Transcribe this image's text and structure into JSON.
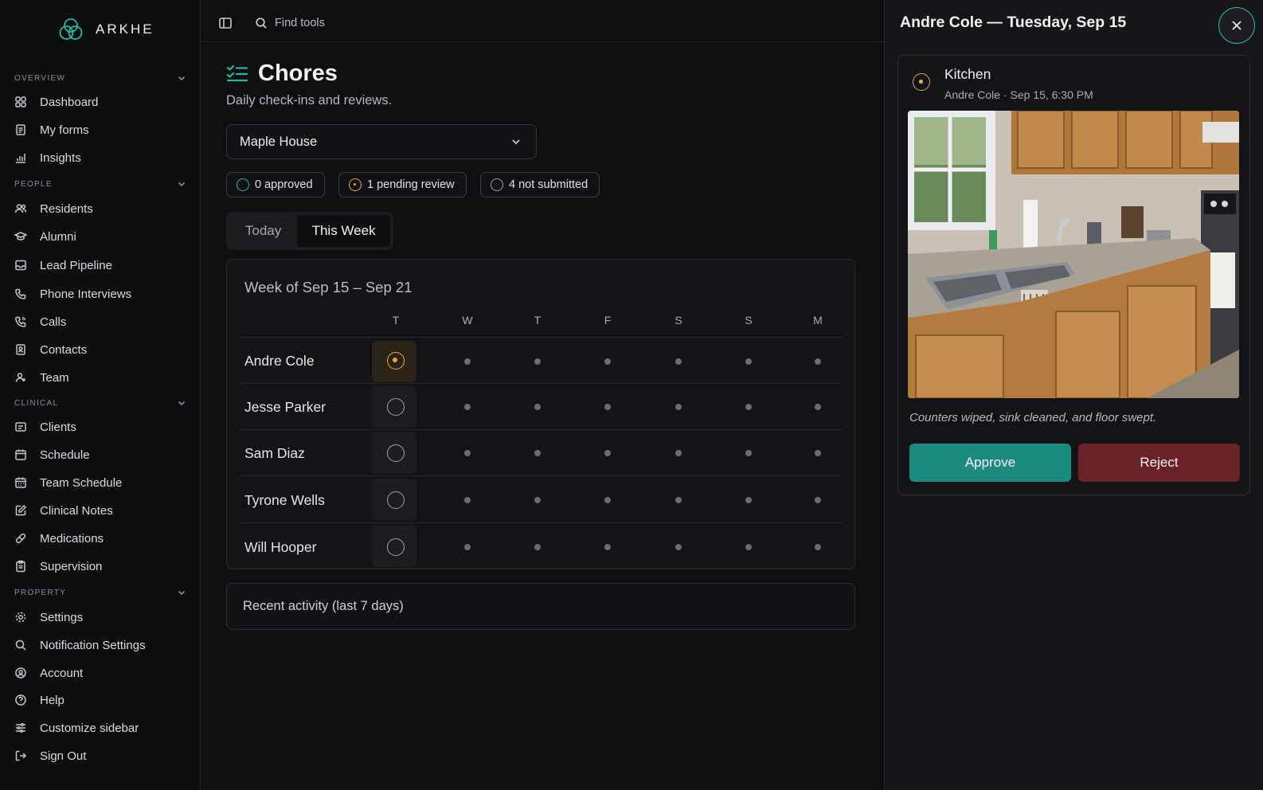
{
  "brand": {
    "name": "ARKHE"
  },
  "sidebar": {
    "sections": [
      {
        "label": "OVERVIEW",
        "items": [
          {
            "label": "Dashboard",
            "icon": "dashboard-icon"
          },
          {
            "label": "My forms",
            "icon": "forms-icon"
          },
          {
            "label": "Insights",
            "icon": "insights-icon"
          }
        ]
      },
      {
        "label": "PEOPLE",
        "items": [
          {
            "label": "Residents",
            "icon": "residents-icon"
          },
          {
            "label": "Alumni",
            "icon": "graduation-cap-icon"
          },
          {
            "label": "Lead Pipeline",
            "icon": "inbox-icon"
          },
          {
            "label": "Phone Interviews",
            "icon": "phone-icon"
          },
          {
            "label": "Calls",
            "icon": "phone-call-icon"
          },
          {
            "label": "Contacts",
            "icon": "contacts-icon"
          },
          {
            "label": "Team",
            "icon": "team-icon"
          }
        ]
      },
      {
        "label": "CLINICAL",
        "items": [
          {
            "label": "Clients",
            "icon": "clients-icon"
          },
          {
            "label": "Schedule",
            "icon": "calendar-icon"
          },
          {
            "label": "Team Schedule",
            "icon": "calendar-grid-icon"
          },
          {
            "label": "Clinical Notes",
            "icon": "note-edit-icon"
          },
          {
            "label": "Medications",
            "icon": "pill-icon"
          },
          {
            "label": "Supervision",
            "icon": "clipboard-icon"
          }
        ]
      },
      {
        "label": "PROPERTY",
        "items": [
          {
            "label": "Settings",
            "icon": "gear-icon"
          },
          {
            "label": "Notification Settings",
            "icon": "search-icon"
          },
          {
            "label": "Account",
            "icon": "account-icon"
          },
          {
            "label": "Help",
            "icon": "help-icon"
          },
          {
            "label": "Customize sidebar",
            "icon": "sliders-icon"
          },
          {
            "label": "Sign Out",
            "icon": "sign-out-icon"
          }
        ]
      }
    ]
  },
  "topbar": {
    "search_label": "Find tools"
  },
  "page": {
    "title": "Chores",
    "subtitle": "Daily check-ins and reviews.",
    "house_select": "Maple House",
    "stats": {
      "approved": "0 approved",
      "pending": "1 pending review",
      "not_submitted": "4 not submitted"
    },
    "tabs": [
      "Today",
      "This Week"
    ],
    "active_tab": "This Week"
  },
  "week": {
    "title": "Week of Sep 15 – Sep 21",
    "days": [
      "T",
      "W",
      "T",
      "F",
      "S",
      "S",
      "M"
    ],
    "rows": [
      {
        "name": "Andre Cole",
        "today_status": "pending"
      },
      {
        "name": "Jesse Parker",
        "today_status": "not_submitted"
      },
      {
        "name": "Sam Diaz",
        "today_status": "not_submitted"
      },
      {
        "name": "Tyrone Wells",
        "today_status": "not_submitted"
      },
      {
        "name": "Will Hooper",
        "today_status": "not_submitted"
      }
    ]
  },
  "activity": {
    "label": "Recent activity (last 7 days)"
  },
  "panel": {
    "title": "Andre Cole — Tuesday, Sep 15",
    "submission": {
      "title": "Kitchen",
      "meta": "Andre Cole · Sep 15, 6:30 PM",
      "note": "Counters wiped, sink cleaned, and floor swept.",
      "approve_label": "Approve",
      "reject_label": "Reject"
    }
  },
  "colors": {
    "accent": "#2bb5a0",
    "pending": "#e7a93b",
    "approve": "#1d8a80",
    "reject": "#6a2227"
  }
}
